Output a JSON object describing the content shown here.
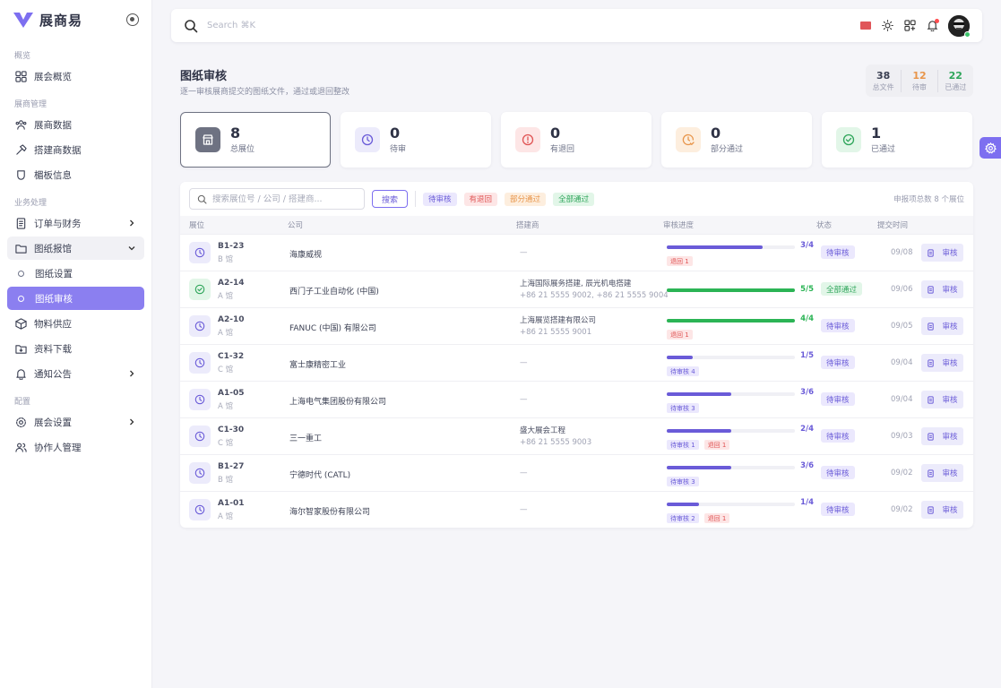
{
  "brand": {
    "name": "展商易",
    "color": "#7d6ff0"
  },
  "topbar": {
    "search_placeholder": "Search ⌘K"
  },
  "sidebar": {
    "sections": [
      {
        "title": "概览",
        "items": [
          {
            "label": "展会概览",
            "icon": "grid-icon"
          }
        ]
      },
      {
        "title": "展商管理",
        "items": [
          {
            "label": "展商数据",
            "icon": "users-icon"
          },
          {
            "label": "搭建商数据",
            "icon": "hammer-icon"
          },
          {
            "label": "楣板信息",
            "icon": "badge-icon"
          }
        ]
      },
      {
        "title": "业务处理",
        "items": [
          {
            "label": "订单与财务",
            "icon": "receipt-icon",
            "chevron": "right"
          },
          {
            "label": "图纸报馆",
            "icon": "folder-icon",
            "chevron": "down",
            "open": true
          },
          {
            "label": "图纸设置",
            "sub": true
          },
          {
            "label": "图纸审核",
            "sub": true,
            "active": true
          },
          {
            "label": "物料供应",
            "icon": "box-icon"
          },
          {
            "label": "资料下载",
            "icon": "folder-download-icon"
          },
          {
            "label": "通知公告",
            "icon": "bell-icon",
            "chevron": "right"
          }
        ]
      },
      {
        "title": "配置",
        "items": [
          {
            "label": "展会设置",
            "icon": "gear-icon",
            "chevron": "right"
          },
          {
            "label": "协作人管理",
            "icon": "user-group-icon"
          }
        ]
      }
    ]
  },
  "page": {
    "title": "图纸审核",
    "subtitle": "逐一审核展商提交的图纸文件，通过或退回整改"
  },
  "summary": [
    {
      "value": "38",
      "label": "总文件",
      "color": "#3a3f52"
    },
    {
      "value": "12",
      "label": "待审",
      "color": "#e8954a"
    },
    {
      "value": "22",
      "label": "已通过",
      "color": "#2ea55a"
    }
  ],
  "stats": [
    {
      "value": "8",
      "label": "总展位",
      "icon": "store-icon",
      "bg": "#6e7282",
      "fg": "#ffffff",
      "selected": true
    },
    {
      "value": "0",
      "label": "待审",
      "icon": "clock-icon",
      "bg": "#ecebfb",
      "fg": "#6a5bd8"
    },
    {
      "value": "0",
      "label": "有退回",
      "icon": "alert-icon",
      "bg": "#fde6e6",
      "fg": "#e05454"
    },
    {
      "value": "0",
      "label": "部分通过",
      "icon": "clock-check-icon",
      "bg": "#fdeede",
      "fg": "#e8954a"
    },
    {
      "value": "1",
      "label": "已通过",
      "icon": "check-circle-icon",
      "bg": "#e2f6e8",
      "fg": "#2ea55a"
    }
  ],
  "filters": {
    "search_placeholder": "搜索展位号 / 公司 / 搭建商...",
    "search_button": "搜索",
    "chips": [
      {
        "label": "待审核",
        "kind": "pending"
      },
      {
        "label": "有退回",
        "kind": "returned"
      },
      {
        "label": "部分通过",
        "kind": "partial"
      },
      {
        "label": "全部通过",
        "kind": "passed"
      }
    ],
    "count_text": "申报项总数 8 个展位"
  },
  "table": {
    "columns": [
      "展位",
      "公司",
      "搭建商",
      "审核进度",
      "状态",
      "提交时间"
    ],
    "rows": [
      {
        "booth": "B1-23",
        "hall": "B 馆",
        "company": "海康威视",
        "builder": "",
        "builder_phone": "",
        "done": 3,
        "total": 4,
        "ratio": "3/4",
        "tags": [
          {
            "label": "退回 1",
            "kind": "returned"
          }
        ],
        "status": "待审核",
        "status_kind": "pending",
        "date": "09/08",
        "icon": "clock"
      },
      {
        "booth": "A2-14",
        "hall": "A 馆",
        "company": "西门子工业自动化 (中国)",
        "builder": "上海国际展务搭建, 辰光机电搭建",
        "builder_phone": "+86 21 5555 9002, +86 21 5555 9004",
        "done": 5,
        "total": 5,
        "ratio": "5/5",
        "tags": [],
        "status": "全部通过",
        "status_kind": "passed",
        "date": "09/06",
        "icon": "check"
      },
      {
        "booth": "A2-10",
        "hall": "A 馆",
        "company": "FANUC (中国) 有限公司",
        "builder": "上海展览搭建有限公司",
        "builder_phone": "+86 21 5555 9001",
        "done": 4,
        "total": 4,
        "ratio": "4/4",
        "tags": [
          {
            "label": "退回 1",
            "kind": "returned"
          }
        ],
        "status": "待审核",
        "status_kind": "pending",
        "date": "09/05",
        "icon": "clock"
      },
      {
        "booth": "C1-32",
        "hall": "C 馆",
        "company": "富士康精密工业",
        "builder": "",
        "builder_phone": "",
        "done": 1,
        "total": 5,
        "ratio": "1/5",
        "tags": [
          {
            "label": "待审核 4",
            "kind": "pending"
          }
        ],
        "status": "待审核",
        "status_kind": "pending",
        "date": "09/04",
        "icon": "clock"
      },
      {
        "booth": "A1-05",
        "hall": "A 馆",
        "company": "上海电气集团股份有限公司",
        "builder": "",
        "builder_phone": "",
        "done": 3,
        "total": 6,
        "ratio": "3/6",
        "tags": [
          {
            "label": "待审核 3",
            "kind": "pending"
          }
        ],
        "status": "待审核",
        "status_kind": "pending",
        "date": "09/04",
        "icon": "clock"
      },
      {
        "booth": "C1-30",
        "hall": "C 馆",
        "company": "三一重工",
        "builder": "盛大展会工程",
        "builder_phone": "+86 21 5555 9003",
        "done": 2,
        "total": 4,
        "ratio": "2/4",
        "tags": [
          {
            "label": "待审核 1",
            "kind": "pending"
          },
          {
            "label": "退回 1",
            "kind": "returned"
          }
        ],
        "status": "待审核",
        "status_kind": "pending",
        "date": "09/03",
        "icon": "clock"
      },
      {
        "booth": "B1-27",
        "hall": "B 馆",
        "company": "宁德时代 (CATL)",
        "builder": "",
        "builder_phone": "",
        "done": 3,
        "total": 6,
        "ratio": "3/6",
        "tags": [
          {
            "label": "待审核 3",
            "kind": "pending"
          }
        ],
        "status": "待审核",
        "status_kind": "pending",
        "date": "09/02",
        "icon": "clock"
      },
      {
        "booth": "A1-01",
        "hall": "A 馆",
        "company": "海尔智家股份有限公司",
        "builder": "",
        "builder_phone": "",
        "done": 1,
        "total": 4,
        "ratio": "1/4",
        "tags": [
          {
            "label": "待审核 2",
            "kind": "pending"
          },
          {
            "label": "退回 1",
            "kind": "returned"
          }
        ],
        "status": "待审核",
        "status_kind": "pending",
        "date": "09/02",
        "icon": "clock"
      }
    ],
    "empty_builder": "—",
    "review_label": "审核"
  }
}
